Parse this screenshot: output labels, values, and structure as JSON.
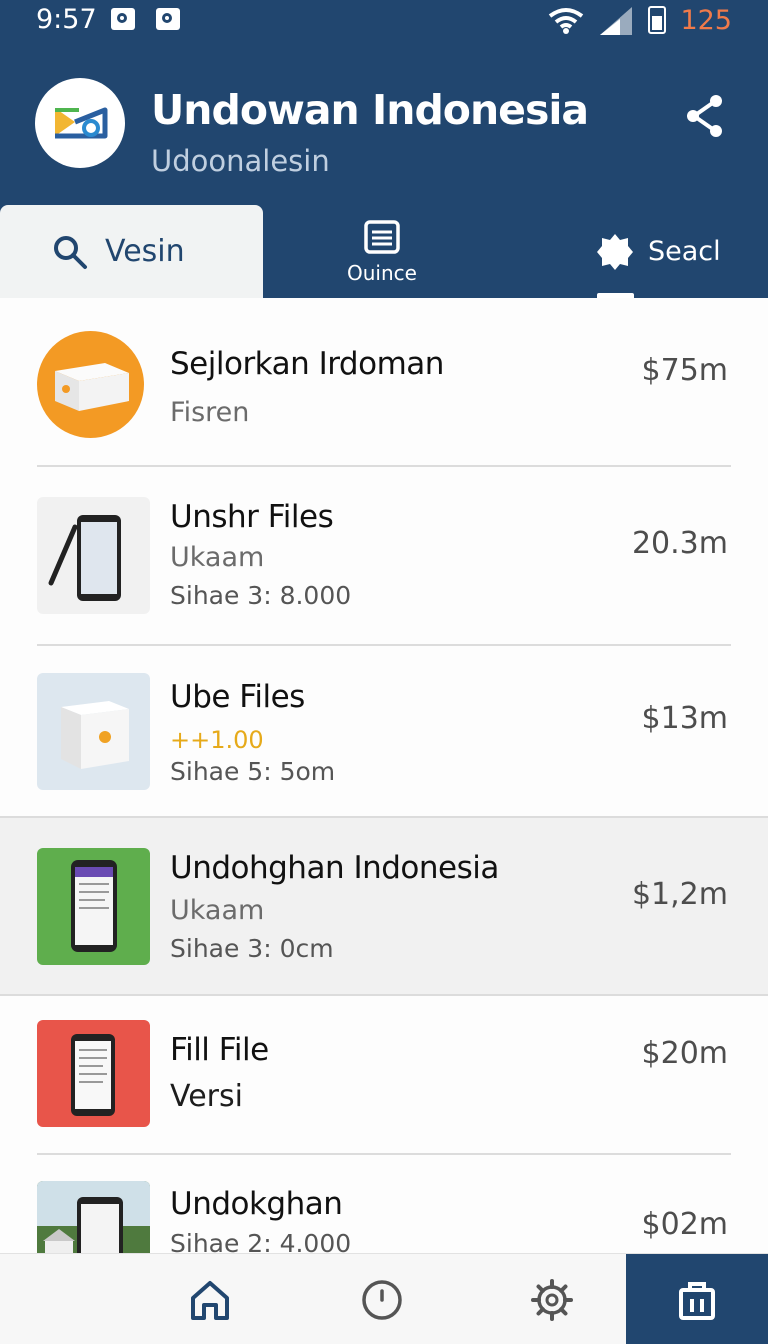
{
  "status_bar": {
    "time": "9:57",
    "battery_level": "125",
    "icons": [
      "notification-icon",
      "notification-icon",
      "wifi-icon",
      "cell-signal-icon",
      "battery-icon"
    ]
  },
  "header": {
    "title": "Undowan Indonesia",
    "subtitle": "Udoonalesin",
    "share_icon": "share-icon",
    "background_color": "#21466f"
  },
  "tabs": [
    {
      "label": "Vesin",
      "icon": "search-icon",
      "active": true
    },
    {
      "label": "Ouince",
      "icon": "list-icon",
      "active": false
    },
    {
      "label": "Seacl",
      "icon": "badge-icon",
      "active": false
    }
  ],
  "items": [
    {
      "name": "Sejlorkan Irdoman",
      "line1": "Fisren",
      "line2": "",
      "price": "$75m",
      "thumb_color": "#f39a24",
      "thumb_icon": "box-icon"
    },
    {
      "name": "Unshr Files",
      "line1": "Ukaam",
      "line2": "Sihae 3: 8.000",
      "price": "20.3m",
      "thumb_color": "#f1f1f1",
      "thumb_icon": "phone-icon"
    },
    {
      "name": "Ube Files",
      "line1": "++1.00",
      "line2": "Sihae 5: 5om",
      "price": "$13m",
      "thumb_color": "#dde7ef",
      "thumb_icon": "box-icon"
    },
    {
      "name": "Undohghan Indonesia",
      "line1": "Ukaam",
      "line2": "Sihae 3: 0cm",
      "price": "$1,2m",
      "thumb_color": "#5fae4d",
      "thumb_icon": "phone-icon"
    },
    {
      "name": "Fill File",
      "line1": "Versi",
      "line2": "",
      "price": "$20m",
      "thumb_color": "#e8554a",
      "thumb_icon": "phone-icon"
    },
    {
      "name": "Undokghan",
      "line1": "Sihae 2: 4.000",
      "line2": "",
      "price": "$02m",
      "thumb_color": "#4f7a3e",
      "thumb_icon": "photo-icon"
    }
  ],
  "bottom_nav": [
    {
      "icon": "home-icon",
      "active": false
    },
    {
      "icon": "clock-icon",
      "active": false
    },
    {
      "icon": "gear-icon",
      "active": false
    },
    {
      "icon": "bag-icon",
      "active": true
    }
  ]
}
